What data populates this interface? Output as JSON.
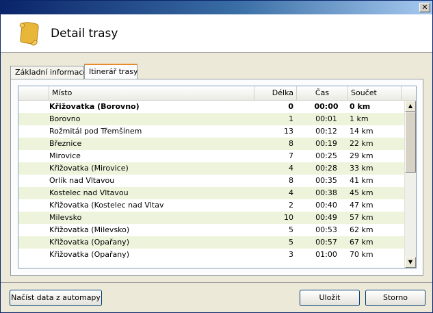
{
  "window": {
    "close_label": "✕"
  },
  "header": {
    "title": "Detail trasy",
    "icon": "scroll-icon"
  },
  "tabs": [
    {
      "label": "Základní informace",
      "active": false
    },
    {
      "label": "Itinerář trasy",
      "active": true
    }
  ],
  "list": {
    "columns": {
      "place": "Místo",
      "length": "Délka",
      "time": "Čas",
      "sum": "Součet"
    },
    "rows": [
      {
        "place": "Křižovatka (Borovno)",
        "length": "0",
        "time": "00:00",
        "sum": "0 km"
      },
      {
        "place": "Borovno",
        "length": "1",
        "time": "00:01",
        "sum": "1 km"
      },
      {
        "place": "Rožmitál pod Třemšínem",
        "length": "13",
        "time": "00:12",
        "sum": "14 km"
      },
      {
        "place": "Březnice",
        "length": "8",
        "time": "00:19",
        "sum": "22 km"
      },
      {
        "place": "Mirovice",
        "length": "7",
        "time": "00:25",
        "sum": "29 km"
      },
      {
        "place": "Křižovatka (Mirovice)",
        "length": "4",
        "time": "00:28",
        "sum": "33 km"
      },
      {
        "place": "Orlík nad Vltavou",
        "length": "8",
        "time": "00:35",
        "sum": "41 km"
      },
      {
        "place": "Kostelec nad Vltavou",
        "length": "4",
        "time": "00:38",
        "sum": "45 km"
      },
      {
        "place": "Křižovatka (Kostelec nad Vltav",
        "length": "2",
        "time": "00:40",
        "sum": "47 km"
      },
      {
        "place": "Milevsko",
        "length": "10",
        "time": "00:49",
        "sum": "57 km"
      },
      {
        "place": "Křižovatka (Milevsko)",
        "length": "5",
        "time": "00:53",
        "sum": "62 km"
      },
      {
        "place": "Křižovatka (Opařany)",
        "length": "5",
        "time": "00:57",
        "sum": "67 km"
      },
      {
        "place": "Křižovatka (Opařany)",
        "length": "3",
        "time": "01:00",
        "sum": "70 km"
      }
    ],
    "scroll_up": "▲",
    "scroll_down": "▼"
  },
  "buttons": {
    "load": "Načíst data z automapy",
    "save": "Uložit",
    "cancel": "Storno"
  },
  "colors": {
    "title_bar": "#0a246a",
    "row_alt": "#eef4dc",
    "active_tab_accent": "#e68b2c"
  }
}
